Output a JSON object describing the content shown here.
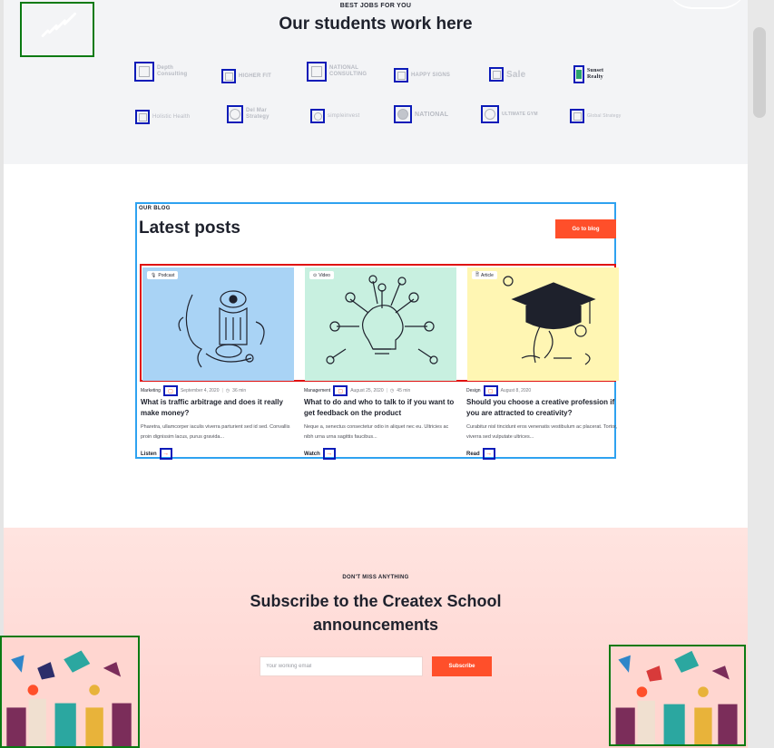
{
  "partners": {
    "eyebrow": "BEST JOBS FOR YOU",
    "title": "Our students work here",
    "logos": [
      {
        "text": "Depth\nConsulting"
      },
      {
        "text": "HIGHER FIT"
      },
      {
        "text": "NATIONAL\nCONSULTING"
      },
      {
        "text": "HAPPY SIGNS"
      },
      {
        "text": "Sale"
      },
      {
        "text": "Sunset\nRealty"
      },
      {
        "text": "Holistic Health"
      },
      {
        "text": "Del Mar\nStrategy"
      },
      {
        "text": "simpleinvest"
      },
      {
        "text": "NATIONAL"
      },
      {
        "text": "ULTIMATE GYM"
      },
      {
        "text": "Global Strategy"
      }
    ]
  },
  "blog": {
    "eyebrow": "OUR BLOG",
    "title": "Latest posts",
    "button": "Go to blog",
    "posts": [
      {
        "tag": "Podcast",
        "category": "Marketing",
        "date": "September 4, 2020",
        "duration": "36 min",
        "title": "What is traffic arbitrage and does it really make money?",
        "desc": "Pharetra, ullamcorper iaculis viverra parturient sed id sed. Convallis proin dignissim lacus, purus gravida...",
        "link": "Listen",
        "bg": "#a9d3f5"
      },
      {
        "tag": "Video",
        "category": "Management",
        "date": "August 25, 2020",
        "duration": "45 min",
        "title": "What to do and who to talk to if you want to get feedback on the product",
        "desc": "Neque a, senectus consectetur odio in aliquet nec eu. Ultricies ac nibh urna urna sagittis faucibus...",
        "link": "Watch",
        "bg": "#c8f0e0"
      },
      {
        "tag": "Article",
        "category": "Design",
        "date": "August 8, 2020",
        "duration": "",
        "title": "Should you choose a creative profession if you are attracted to creativity?",
        "desc": "Curabitur nisl tincidunt eros venenatis vestibulum ac placerat. Tortor, viverra sed vulputate ultrices...",
        "link": "Read",
        "bg": "#fff6b3"
      }
    ]
  },
  "subscribe": {
    "eyebrow": "DON'T MISS ANYTHING",
    "title": "Subscribe to the Createx School announcements",
    "placeholder": "Your working email",
    "button": "Subscribe"
  },
  "colors": {
    "accent": "#ff4f2a",
    "annotation_blue": "#0b1bb8",
    "annotation_green": "#0a7a12",
    "annotation_red": "#e01010",
    "annotation_lightblue": "#2ea2f0"
  }
}
